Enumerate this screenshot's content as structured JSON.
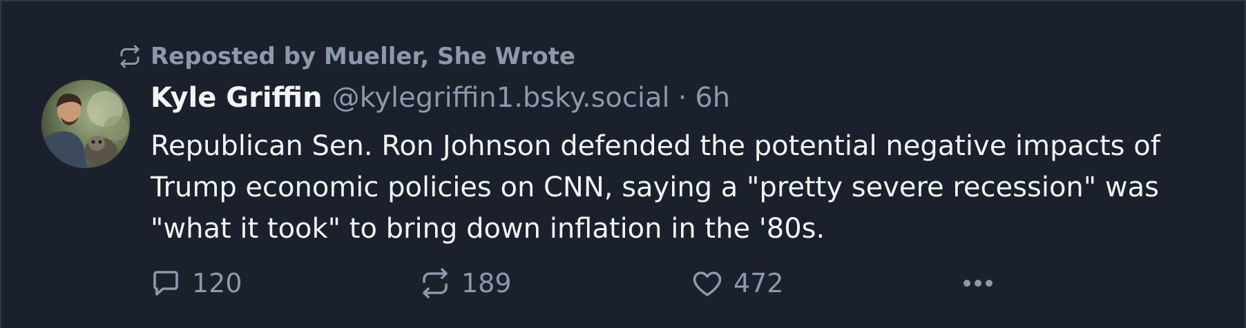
{
  "repost": {
    "label": "Reposted by Mueller, She Wrote",
    "icon": "repost-icon"
  },
  "author": {
    "display_name": "Kyle Griffin",
    "handle": "@kylegriffin1.bsky.social",
    "separator": "·",
    "time": "6h",
    "avatar": "avatar-photo"
  },
  "post": {
    "text": "Republican Sen. Ron Johnson defended the potential negative impacts of Trump economic policies on CNN, saying a \"pretty severe recession\" was \"what it took\" to bring down inflation in the '80s."
  },
  "actions": {
    "reply_count": "120",
    "repost_count": "189",
    "like_count": "472",
    "reply_icon": "reply-bubble-icon",
    "repost_icon": "repost-icon",
    "like_icon": "heart-icon",
    "more_icon": "more-dots-icon"
  },
  "colors": {
    "background": "#1b212c",
    "text_primary": "#f1f3f5",
    "text_muted": "#8d99ab",
    "border": "#2e3847"
  }
}
